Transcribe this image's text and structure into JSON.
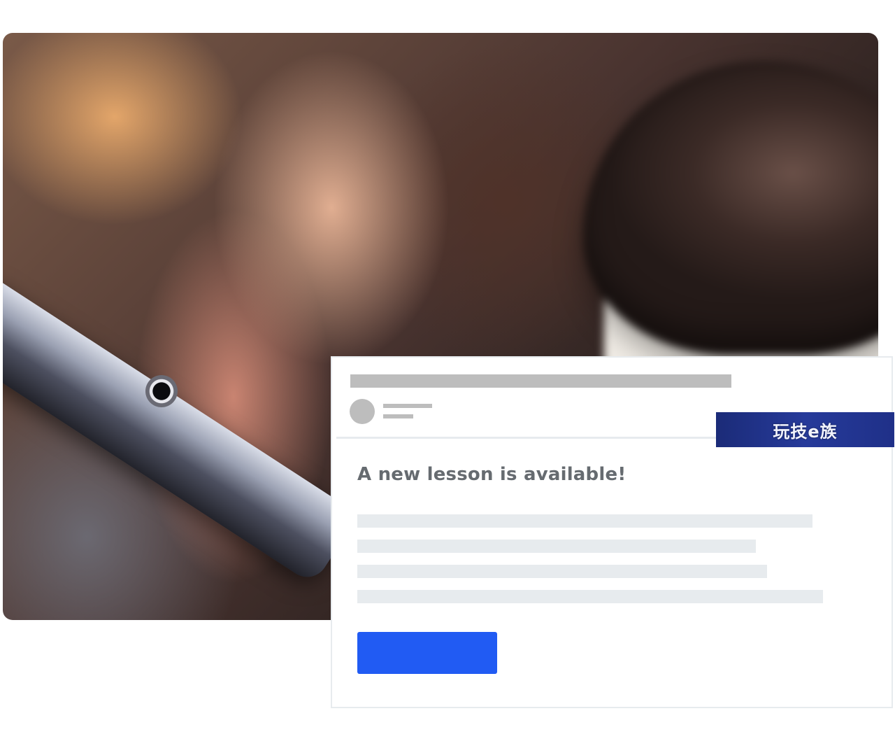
{
  "email_preview": {
    "heading": "A new lesson is available!"
  },
  "watermark": {
    "text": "玩技e族"
  },
  "colors": {
    "cta_blue": "#215bf3",
    "placeholder_gray": "#bdbdbd",
    "body_line_gray": "#e7ebee",
    "heading_gray": "#666b70"
  }
}
